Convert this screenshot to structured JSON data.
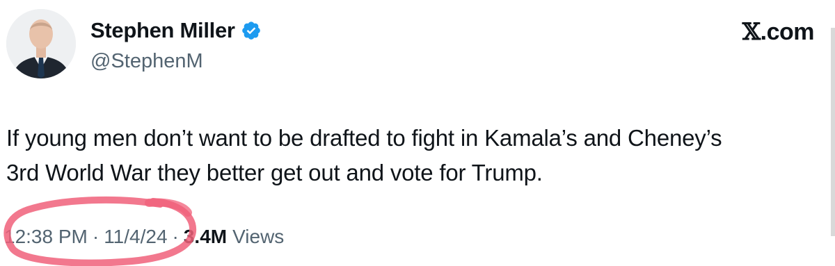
{
  "tweet": {
    "author": {
      "display_name": "Stephen Miller",
      "handle": "@StephenM",
      "verified": true,
      "avatar": "profile-photo"
    },
    "brand": {
      "x_glyph": "𝕏",
      "suffix": ".com"
    },
    "text_lines": [
      "If young men don’t want to be drafted to fight in Kamala’s and Cheney’s",
      "3rd World War they better get out and vote for Trump."
    ],
    "meta": {
      "time": "12:38 PM",
      "separator": "·",
      "date": "11/4/24",
      "views_count": "3.4M",
      "views_label": "Views"
    },
    "annotation": {
      "shape": "hand-drawn-circle",
      "color": "#f0607a"
    },
    "colors": {
      "verified": "#1d9bf0",
      "text_primary": "#0f1419",
      "text_secondary": "#536471"
    }
  }
}
